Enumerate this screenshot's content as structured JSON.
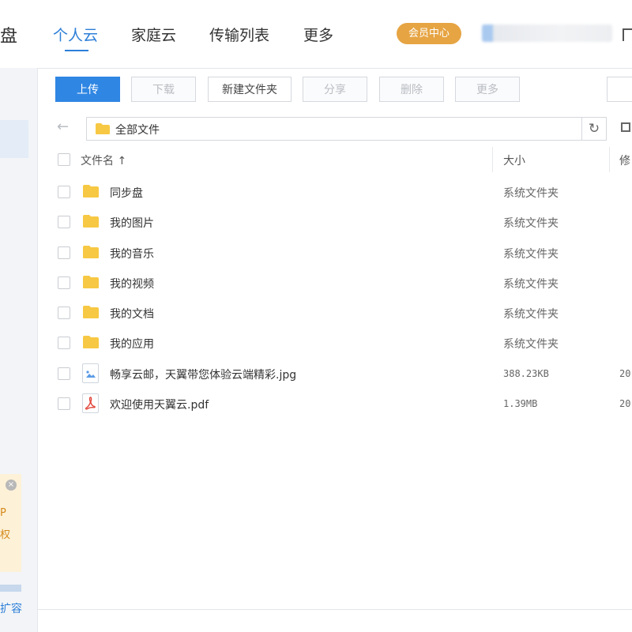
{
  "header": {
    "logo_fragment": "盘",
    "tabs": [
      {
        "label": "个人云",
        "active": true
      },
      {
        "label": "家庭云",
        "active": false
      },
      {
        "label": "传输列表",
        "active": false
      },
      {
        "label": "更多",
        "active": false
      }
    ],
    "vip_label": "会员中心"
  },
  "sidebar": {
    "promo_line1": "P",
    "promo_line2": "权",
    "expand_label": "扩容"
  },
  "toolbar": {
    "upload": "上传",
    "download": "下载",
    "new_folder": "新建文件夹",
    "share": "分享",
    "delete": "删除",
    "more": "更多"
  },
  "path": {
    "current": "全部文件"
  },
  "table": {
    "columns": {
      "name": "文件名 ↑",
      "size": "大小",
      "modified_fragment": "修"
    },
    "rows": [
      {
        "name": "同步盘",
        "size": "系统文件夹",
        "date": "",
        "type": "folder"
      },
      {
        "name": "我的图片",
        "size": "系统文件夹",
        "date": "",
        "type": "folder"
      },
      {
        "name": "我的音乐",
        "size": "系统文件夹",
        "date": "",
        "type": "folder"
      },
      {
        "name": "我的视频",
        "size": "系统文件夹",
        "date": "",
        "type": "folder"
      },
      {
        "name": "我的文档",
        "size": "系统文件夹",
        "date": "",
        "type": "folder"
      },
      {
        "name": "我的应用",
        "size": "系统文件夹",
        "date": "",
        "type": "folder"
      },
      {
        "name": "畅享云邮，天翼带您体验云端精彩.jpg",
        "size": "388.23KB",
        "date": "20",
        "type": "image"
      },
      {
        "name": "欢迎使用天翼云.pdf",
        "size": "1.39MB",
        "date": "20",
        "type": "pdf"
      }
    ]
  },
  "colors": {
    "accent": "#2d7fd8",
    "vip": "#e6a443",
    "folder": "#f7c843",
    "pdf": "#e2463b"
  }
}
